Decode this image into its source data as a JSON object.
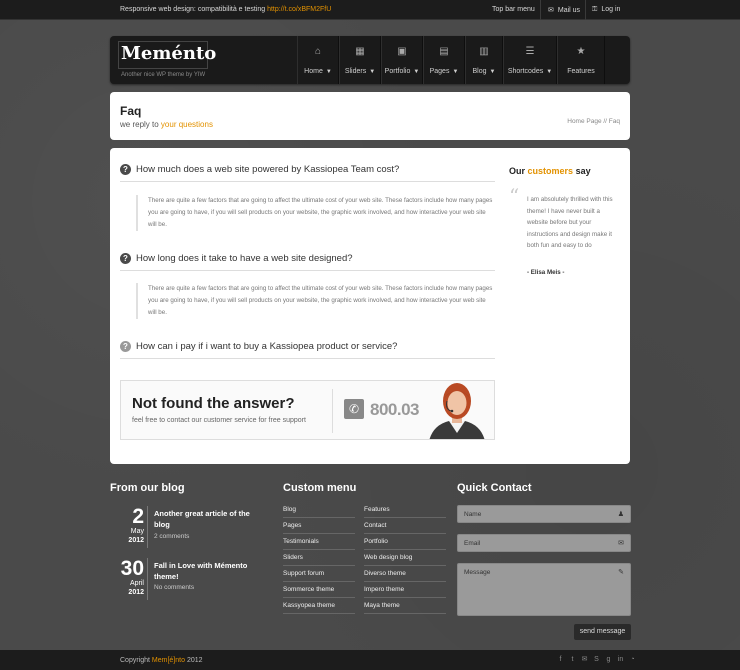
{
  "topbar": {
    "tagline": "Responsive web design: compatibilità e testing",
    "tagline_link": "http://t.co/xBFM2FfU",
    "menu_label": "Top bar menu",
    "mail_label": "Mail us",
    "login_label": "Log in"
  },
  "header": {
    "logo_text": "Meménto",
    "logo_tagline": "Another nice WP theme by YIW",
    "nav": [
      {
        "label": "Home",
        "icon": "home-icon",
        "glyph": "⌂",
        "has_caret": true
      },
      {
        "label": "Sliders",
        "icon": "film-icon",
        "glyph": "▦",
        "has_caret": true
      },
      {
        "label": "Portfolio",
        "icon": "image-icon",
        "glyph": "▣",
        "has_caret": true
      },
      {
        "label": "Pages",
        "icon": "document-icon",
        "glyph": "▤",
        "has_caret": true
      },
      {
        "label": "Blog",
        "icon": "calendar-icon",
        "glyph": "▥",
        "has_caret": true
      },
      {
        "label": "Shortcodes",
        "icon": "list-icon",
        "glyph": "☰",
        "has_caret": true
      },
      {
        "label": "Features",
        "icon": "star-icon",
        "glyph": "★",
        "has_caret": false
      }
    ]
  },
  "page": {
    "title": "Faq",
    "subtitle_prefix": "we reply to",
    "subtitle_highlight": "your questions",
    "breadcrumb": "Home Page // Faq"
  },
  "faq": [
    {
      "question": "How much does a web site powered by Kassiopea Team cost?",
      "answer": "There are quite a few factors that are going to affect the ultimate cost of your web site. These factors include how many pages you are going to have, if you will sell products on your website, the graphic work involved, and how interactive your web site will be."
    },
    {
      "question": "How long does it take to have a web site designed?",
      "answer": "There are quite a few factors that are going to affect the ultimate cost of your web site. These factors include how many pages you are going to have, if you will sell products on your website, the graphic work involved, and how interactive your web site will be."
    },
    {
      "question": "How can i pay if i want to buy a Kassiopea product or service?",
      "answer": ""
    }
  ],
  "testimonial": {
    "title_prefix": "Our",
    "title_highlight": "customers",
    "title_suffix": "say",
    "text": "I am absolutely thrilled with this theme! I have never built a website before but your instructions and design make it both fun and easy to do",
    "author": "- Elisa Meis -"
  },
  "cta": {
    "title": "Not found the answer?",
    "subtitle": "feel free to contact our customer service for free support",
    "phone": "800.034"
  },
  "footer": {
    "blog_title": "From our blog",
    "posts": [
      {
        "day": "2",
        "month": "May",
        "year": "2012",
        "title": "Another great article of the blog",
        "comments": "2 comments"
      },
      {
        "day": "30",
        "month": "April",
        "year": "2012",
        "title": "Fall in Love with Mémento theme!",
        "comments": "No comments"
      }
    ],
    "menu_title": "Custom menu",
    "menu_left": [
      "Blog",
      "Pages",
      "Testimonials",
      "Sliders",
      "Support forum",
      "Sommerce theme",
      "Kassyopea theme"
    ],
    "menu_right": [
      "Features",
      "Contact",
      "Portfolio",
      "Web design blog",
      "Diverso theme",
      "Impero theme",
      "Maya theme"
    ],
    "contact_title": "Quick Contact",
    "name_placeholder": "Name",
    "email_placeholder": "Email",
    "message_placeholder": "Message",
    "send_label": "send message"
  },
  "bottombar": {
    "copyright_prefix": "Copyright",
    "brand": "Mem[é]nto",
    "year": "2012"
  },
  "colors": {
    "accent": "#e39200",
    "background": "#4a4a4a",
    "dark": "#1c1c1c"
  }
}
